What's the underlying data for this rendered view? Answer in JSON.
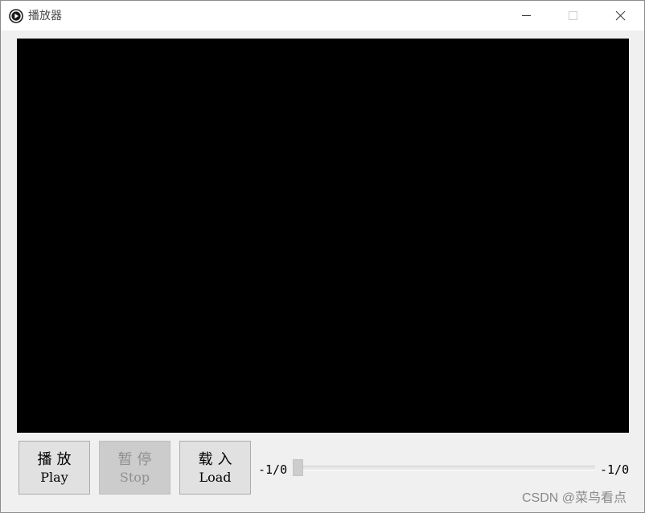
{
  "window": {
    "title": "播放器",
    "icon": "play-circle-icon",
    "controls": {
      "minimize_icon": "minimize-icon",
      "maximize_icon": "maximize-icon",
      "close_icon": "close-icon"
    }
  },
  "player": {
    "video_background": "#000000"
  },
  "buttons": {
    "play": {
      "zh": "播放",
      "en": "Play"
    },
    "stop": {
      "zh": "暂停",
      "en": "Stop",
      "enabled": false
    },
    "load": {
      "zh": "载入",
      "en": "Load"
    }
  },
  "timeline": {
    "current_time": "-1/0",
    "total_time": "-1/0",
    "position": 0
  },
  "watermark": "CSDN @菜鸟看点"
}
